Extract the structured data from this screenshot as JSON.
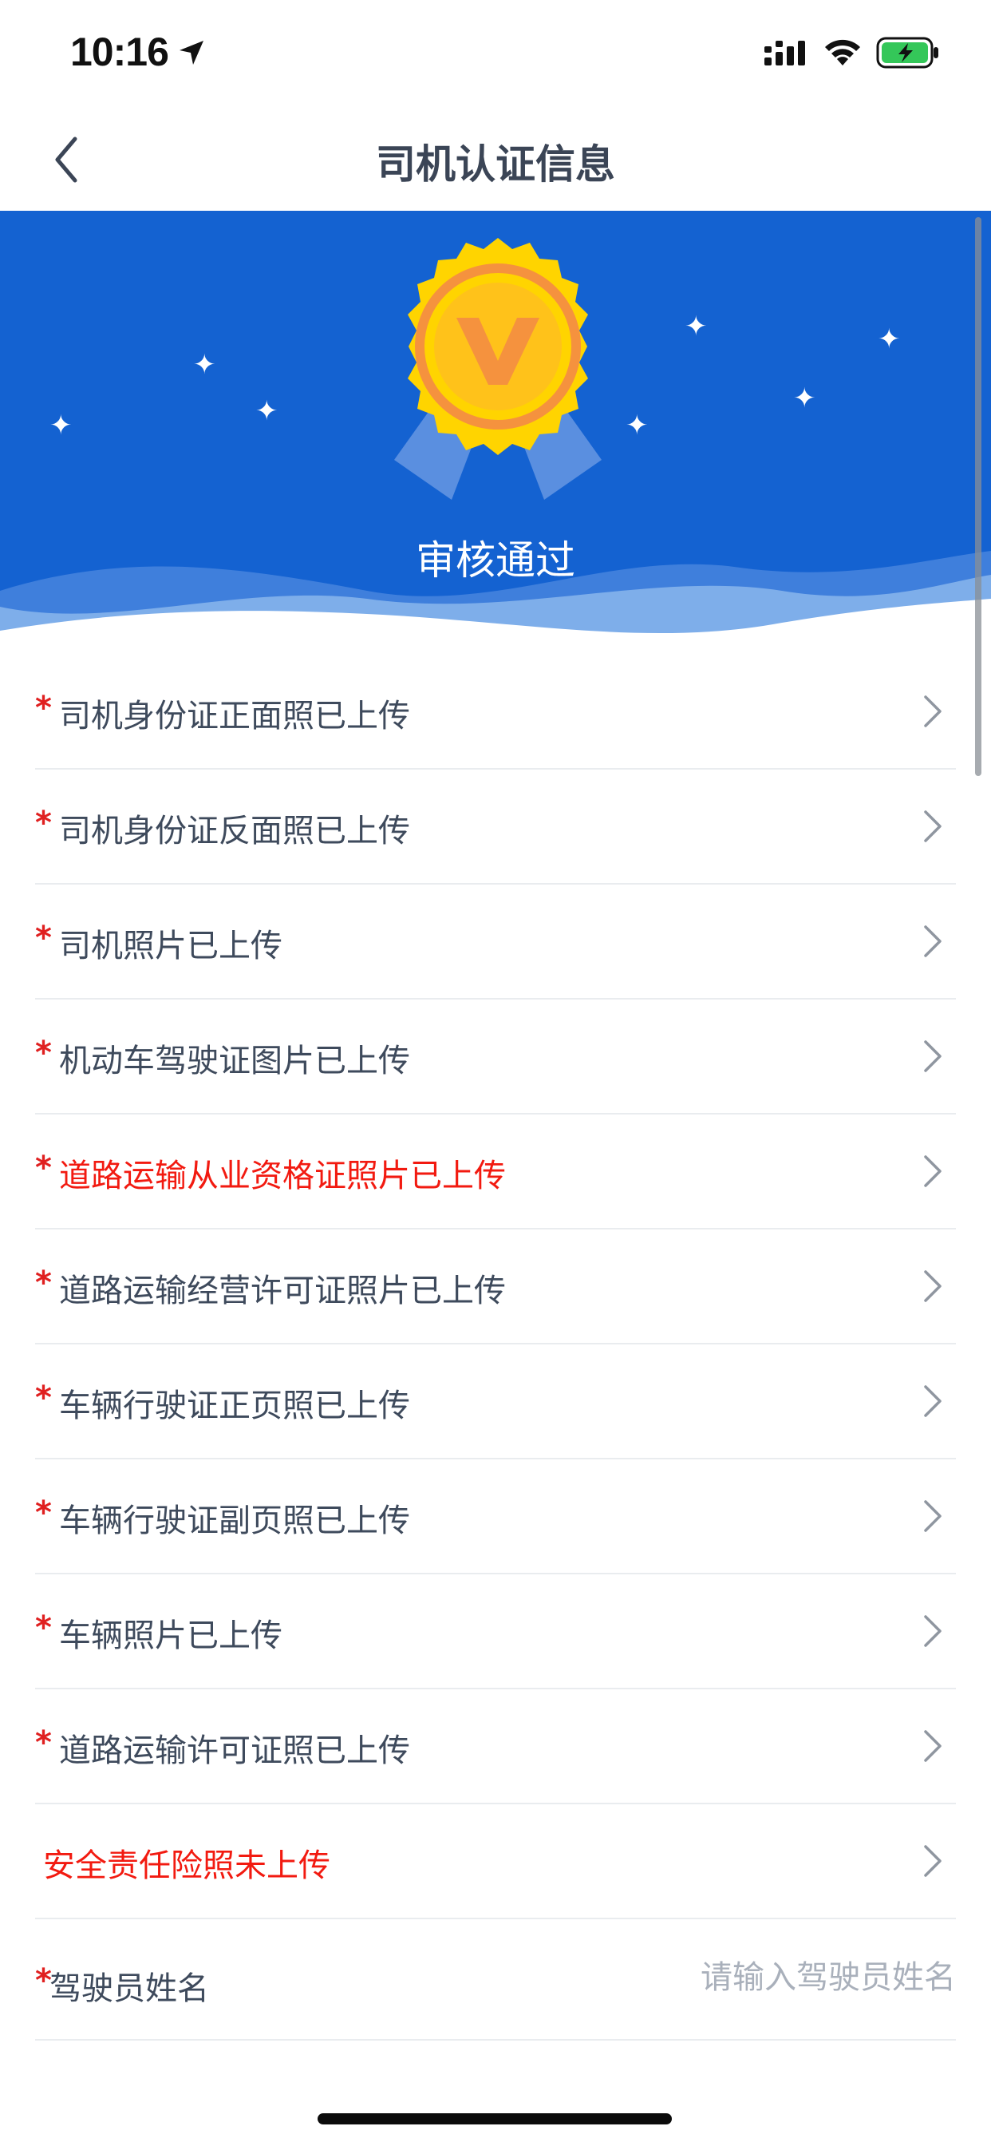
{
  "status_bar": {
    "time": "10:16"
  },
  "nav": {
    "title": "司机认证信息"
  },
  "hero": {
    "status": "审核通过"
  },
  "required_mark": "*",
  "items": [
    {
      "label": "司机身份证正面照已上传",
      "required": true,
      "color": "#3e4a5c"
    },
    {
      "label": "司机身份证反面照已上传",
      "required": true,
      "color": "#3e4a5c"
    },
    {
      "label": "司机照片已上传",
      "required": true,
      "color": "#3e4a5c"
    },
    {
      "label": "机动车驾驶证图片已上传",
      "required": true,
      "color": "#3e4a5c"
    },
    {
      "label": "道路运输从业资格证照片已上传",
      "required": true,
      "color": "#f21a10"
    },
    {
      "label": "道路运输经营许可证照片已上传",
      "required": true,
      "color": "#3e4a5c"
    },
    {
      "label": "车辆行驶证正页照已上传",
      "required": true,
      "color": "#3e4a5c"
    },
    {
      "label": "车辆行驶证副页照已上传",
      "required": true,
      "color": "#3e4a5c"
    },
    {
      "label": "车辆照片已上传",
      "required": true,
      "color": "#3e4a5c"
    },
    {
      "label": "道路运输许可证照已上传",
      "required": true,
      "color": "#3e4a5c"
    },
    {
      "label": "安全责任险照未上传",
      "required": false,
      "color": "#f21a10"
    }
  ],
  "driver_name": {
    "label": "驾驶员姓名",
    "placeholder": "请输入驾驶员姓名",
    "value": ""
  },
  "colors": {
    "hero_bg": "#1462d1",
    "accent_red": "#f21a10",
    "medal_gold": "#ffd400",
    "medal_orange": "#f5923e"
  }
}
